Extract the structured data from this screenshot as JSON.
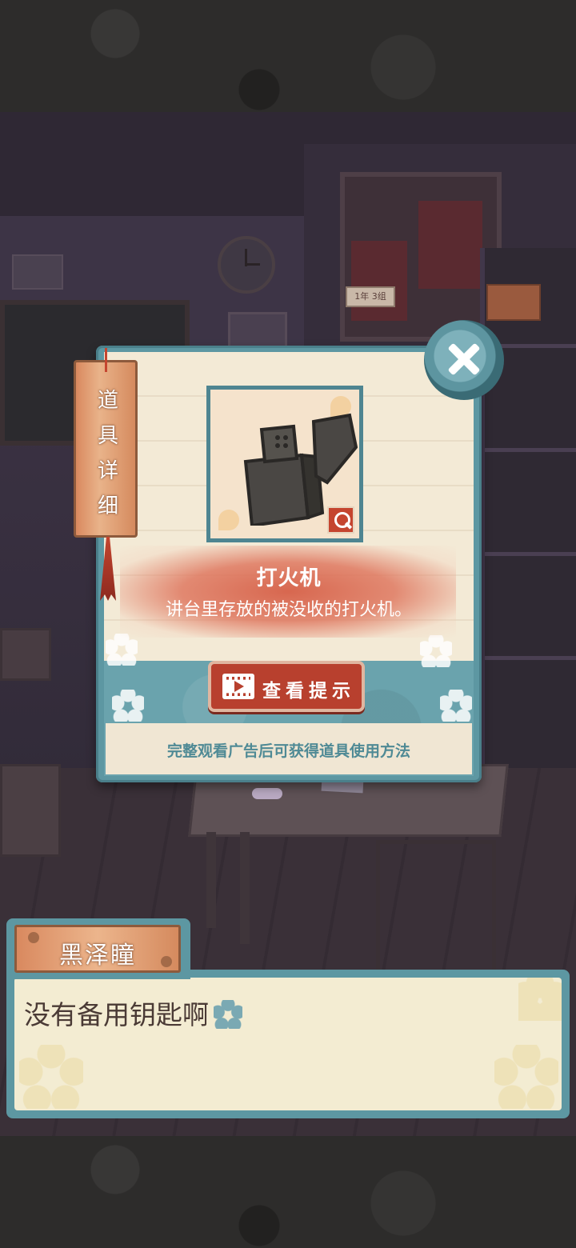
{
  "item_panel": {
    "tag_label": [
      "道",
      "具",
      "详",
      "细"
    ],
    "item_name": "打火机",
    "item_description": "讲台里存放的被没收的打火机。",
    "hint_button_label": "查看提示",
    "footer_note": "完整观看广告后可获得道具使用方法",
    "item_icon": "lighter-icon",
    "zoom_icon": "magnifier-icon",
    "close_icon": "close-icon"
  },
  "scene": {
    "classroom_sign": "1年 3组"
  },
  "dialogue": {
    "speaker": "黑泽瞳",
    "line": "没有备用钥匙啊"
  },
  "colors": {
    "panel_teal": "#5d97a2",
    "accent_red": "#c5452f",
    "paper_cream": "#f3ead6"
  }
}
